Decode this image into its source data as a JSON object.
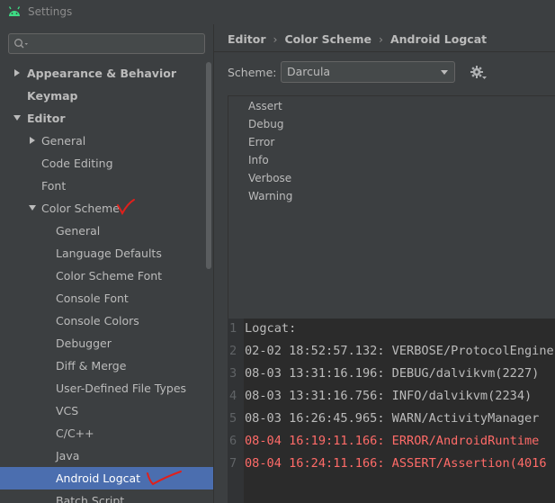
{
  "window": {
    "title": "Settings"
  },
  "search": {
    "placeholder": "Q▾",
    "value": ""
  },
  "tree": [
    {
      "label": "Appearance & Behavior",
      "level": 0,
      "bold": true,
      "arrow": "right"
    },
    {
      "label": "Keymap",
      "level": 0,
      "bold": true,
      "arrow": ""
    },
    {
      "label": "Editor",
      "level": 0,
      "bold": true,
      "arrow": "down"
    },
    {
      "label": "General",
      "level": 1,
      "bold": false,
      "arrow": "right"
    },
    {
      "label": "Code Editing",
      "level": 1,
      "bold": false,
      "arrow": ""
    },
    {
      "label": "Font",
      "level": 1,
      "bold": false,
      "arrow": ""
    },
    {
      "label": "Color Scheme",
      "level": 1,
      "bold": false,
      "arrow": "down"
    },
    {
      "label": "General",
      "level": 2,
      "bold": false,
      "arrow": ""
    },
    {
      "label": "Language Defaults",
      "level": 2,
      "bold": false,
      "arrow": ""
    },
    {
      "label": "Color Scheme Font",
      "level": 2,
      "bold": false,
      "arrow": ""
    },
    {
      "label": "Console Font",
      "level": 2,
      "bold": false,
      "arrow": ""
    },
    {
      "label": "Console Colors",
      "level": 2,
      "bold": false,
      "arrow": ""
    },
    {
      "label": "Debugger",
      "level": 2,
      "bold": false,
      "arrow": ""
    },
    {
      "label": "Diff & Merge",
      "level": 2,
      "bold": false,
      "arrow": ""
    },
    {
      "label": "User-Defined File Types",
      "level": 2,
      "bold": false,
      "arrow": ""
    },
    {
      "label": "VCS",
      "level": 2,
      "bold": false,
      "arrow": ""
    },
    {
      "label": "C/C++",
      "level": 2,
      "bold": false,
      "arrow": ""
    },
    {
      "label": "Java",
      "level": 2,
      "bold": false,
      "arrow": ""
    },
    {
      "label": "Android Logcat",
      "level": 2,
      "bold": false,
      "arrow": "",
      "selected": true
    },
    {
      "label": "Batch Script",
      "level": 2,
      "bold": false,
      "arrow": ""
    }
  ],
  "breadcrumb": [
    "Editor",
    "Color Scheme",
    "Android Logcat"
  ],
  "scheme": {
    "label": "Scheme:",
    "value": "Darcula"
  },
  "attributes": [
    "Assert",
    "Debug",
    "Error",
    "Info",
    "Verbose",
    "Warning"
  ],
  "preview": [
    {
      "num": "1",
      "text": "Logcat:",
      "color": "#bbbbbb"
    },
    {
      "num": "2",
      "text": "02-02 18:52:57.132: VERBOSE/ProtocolEngine",
      "color": "#bbbbbb"
    },
    {
      "num": "3",
      "text": "08-03 13:31:16.196: DEBUG/dalvikvm(2227)",
      "color": "#bbbbbb"
    },
    {
      "num": "4",
      "text": "08-03 13:31:16.756: INFO/dalvikvm(2234)",
      "color": "#bbbbbb"
    },
    {
      "num": "5",
      "text": "08-03 16:26:45.965: WARN/ActivityManager",
      "color": "#bbbbbb"
    },
    {
      "num": "6",
      "text": "08-04 16:19:11.166: ERROR/AndroidRuntime",
      "color": "#ff6b68"
    },
    {
      "num": "7",
      "text": "08-04 16:24:11.166: ASSERT/Assertion(4016",
      "color": "#ff6b68"
    }
  ],
  "colors": {
    "selection": "#4b6eaf",
    "error": "#ff6b68",
    "annotation": "#e0201b"
  }
}
